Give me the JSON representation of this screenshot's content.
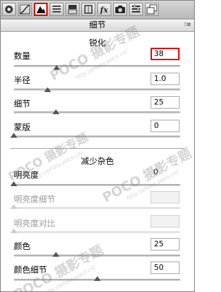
{
  "toolbar": {
    "icons": [
      {
        "name": "basic-icon",
        "label": ""
      },
      {
        "name": "tone-curve-icon",
        "label": ""
      },
      {
        "name": "detail-icon",
        "label": ""
      },
      {
        "name": "hsl-icon",
        "label": ""
      },
      {
        "name": "split-toning-icon",
        "label": ""
      },
      {
        "name": "lens-icon",
        "label": ""
      },
      {
        "name": "fx-icon",
        "label": "fx"
      },
      {
        "name": "camera-calibration-icon",
        "label": ""
      },
      {
        "name": "presets-icon",
        "label": ""
      },
      {
        "name": "snapshots-icon",
        "label": ""
      }
    ],
    "active_index": 2
  },
  "panel": {
    "title": "细节",
    "menu_icon": "⁝≡"
  },
  "sharpening": {
    "title": "锐化",
    "sliders": [
      {
        "label": "数量",
        "value": "38",
        "fraction": 0.25,
        "enabled": true,
        "highlighted": true
      },
      {
        "label": "半径",
        "value": "1.0",
        "fraction": 0.2,
        "enabled": true,
        "highlighted": false
      },
      {
        "label": "细节",
        "value": "25",
        "fraction": 0.25,
        "enabled": true,
        "highlighted": false
      },
      {
        "label": "蒙版",
        "value": "0",
        "fraction": 0.0,
        "enabled": true,
        "highlighted": false
      }
    ]
  },
  "noise_reduction": {
    "title": "减少杂色",
    "sliders": [
      {
        "label": "明亮度",
        "value": "0",
        "fraction": 0.0,
        "enabled": true
      },
      {
        "label": "明亮度细节",
        "value": "",
        "fraction": 0.0,
        "enabled": false
      },
      {
        "label": "明亮度对比",
        "value": "",
        "fraction": 0.0,
        "enabled": false
      },
      {
        "label": "颜色",
        "value": "25",
        "fraction": 0.25,
        "enabled": true
      },
      {
        "label": "颜色细节",
        "value": "50",
        "fraction": 0.5,
        "enabled": true
      }
    ]
  },
  "watermarks": [
    {
      "text": "POCO 摄影专题",
      "sub": "http://photo.poco.cn/"
    },
    {
      "text": "POCO 摄影专题",
      "sub": "http://photo.poco.cn/"
    },
    {
      "text": "POCO 摄影专题",
      "sub": "http://photo.poco.cn/"
    },
    {
      "text": "POCO 摄影专题",
      "sub": "http://photo.poco.cn/"
    }
  ],
  "colors": {
    "highlight": "#e00000",
    "thumb": "#555555"
  }
}
